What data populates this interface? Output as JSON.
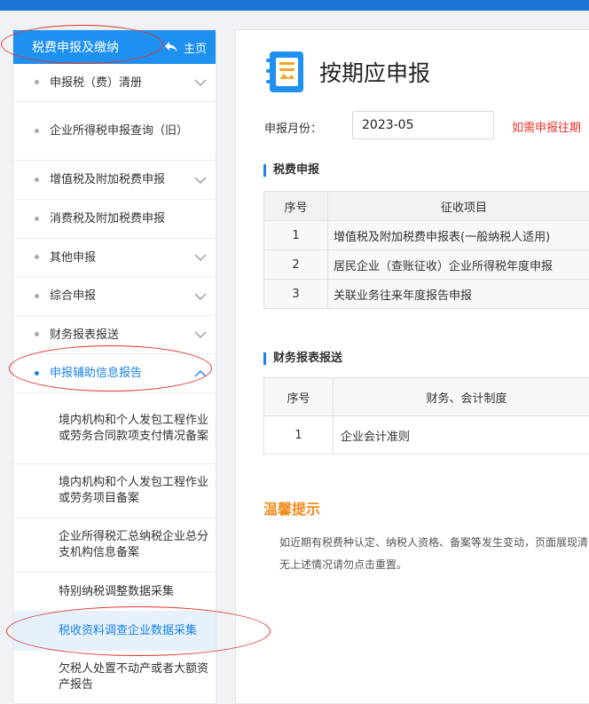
{
  "sidebar": {
    "title": "税费申报及缴纳",
    "home_label": "主页",
    "items": [
      {
        "label": "申报税（费）清册",
        "expandable": true
      },
      {
        "label": "企业所得税申报查询（旧）",
        "expandable": false
      },
      {
        "label": "增值税及附加税费申报",
        "expandable": true
      },
      {
        "label": "消费税及附加税费申报",
        "expandable": false
      },
      {
        "label": "其他申报",
        "expandable": true
      },
      {
        "label": "综合申报",
        "expandable": true
      },
      {
        "label": "财务报表报送",
        "expandable": true
      },
      {
        "label": "申报辅助信息报告",
        "expandable": true,
        "expanded": true
      }
    ],
    "sub_items": [
      {
        "label": "境内机构和个人发包工程作业或劳务合同款项支付情况备案"
      },
      {
        "label": "境内机构和个人发包工程作业或劳务项目备案"
      },
      {
        "label": "企业所得税汇总纳税企业总分支机构信息备案"
      },
      {
        "label": "特别纳税调整数据采集"
      },
      {
        "label": "税收资料调查企业数据采集",
        "active": true
      },
      {
        "label": "欠税人处置不动产或者大额资产报告"
      }
    ]
  },
  "main": {
    "title": "按期应申报",
    "month_label": "申报月份：",
    "month_value": "2023-05",
    "notice": "如需申报往期",
    "tax_section": {
      "title": "税费申报",
      "headers": [
        "序号",
        "征收项目"
      ],
      "rows": [
        {
          "no": "1",
          "item": "增值税及附加税费申报表(一般纳税人适用)"
        },
        {
          "no": "2",
          "item": "居民企业（查账征收）企业所得税年度申报"
        },
        {
          "no": "3",
          "item": "关联业务往来年度报告申报"
        }
      ]
    },
    "finance_section": {
      "title": "财务报表报送",
      "headers": [
        "序号",
        "财务、会计制度"
      ],
      "rows": [
        {
          "no": "1",
          "item": "企业会计准则"
        }
      ]
    },
    "tips": {
      "title": "温馨提示",
      "line1": "如近期有税费种认定、纳税人资格、备案等发生变动，页面展现清",
      "line2": "无上述情况请勿点击重置。"
    }
  },
  "colors": {
    "accent": "#1e90f0",
    "notice": "#e8322b",
    "tips": "#f08a1c",
    "annotation": "#e0332f"
  }
}
